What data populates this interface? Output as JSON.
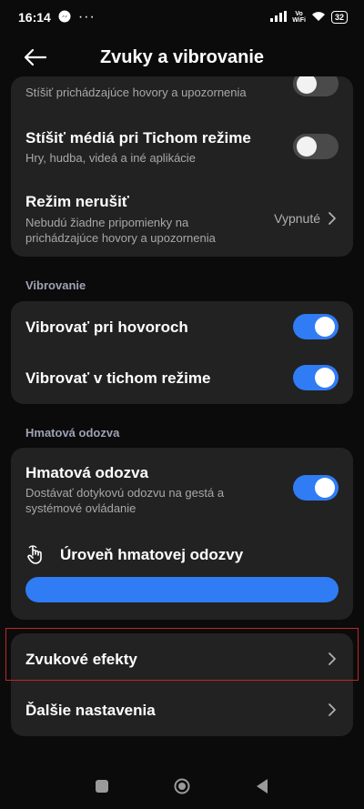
{
  "status_bar": {
    "time": "16:14",
    "dots": "···",
    "vowifi_top": "Vo",
    "vowifi_bottom": "WiFi",
    "battery": "32"
  },
  "header": {
    "title": "Zvuky a vibrovanie"
  },
  "card1": {
    "partial_sub": "Stíšiť prichádzajúce hovory a upozornenia",
    "mute_media_title": "Stíšiť médiá pri Tichom režime",
    "mute_media_sub": "Hry, hudba, videá a iné aplikácie",
    "dnd_title": "Režim nerušiť",
    "dnd_sub": "Nebudú žiadne pripomienky na\nprichádzajúce hovory a upozornenia",
    "dnd_value": "Vypnuté"
  },
  "section_vibration": "Vibrovanie",
  "card2": {
    "vibrate_calls": "Vibrovať pri hovoroch",
    "vibrate_silent": "Vibrovať v tichom režime"
  },
  "section_haptic": "Hmatová odozva",
  "card3": {
    "haptic_title": "Hmatová odozva",
    "haptic_sub": "Dostávať dotykovú odozvu na gestá a\nsystémové ovládanie",
    "haptic_level_label": "Úroveň hmatovej odozvy",
    "haptic_level": 1.0
  },
  "card4": {
    "sound_effects": "Zvukové efekty",
    "more_settings": "Ďalšie nastavenia"
  },
  "toggles": {
    "partial": "off",
    "mute_media": "off",
    "vibrate_calls": "on",
    "vibrate_silent": "on",
    "haptic": "on"
  },
  "colors": {
    "accent": "#2f7cf5",
    "card": "#222222",
    "background": "#0b0b0b",
    "highlight": "#c0262b"
  },
  "icons": {
    "back": "arrow-left-icon",
    "chevron": "chevron-right-icon",
    "haptic": "touch-hand-icon"
  }
}
